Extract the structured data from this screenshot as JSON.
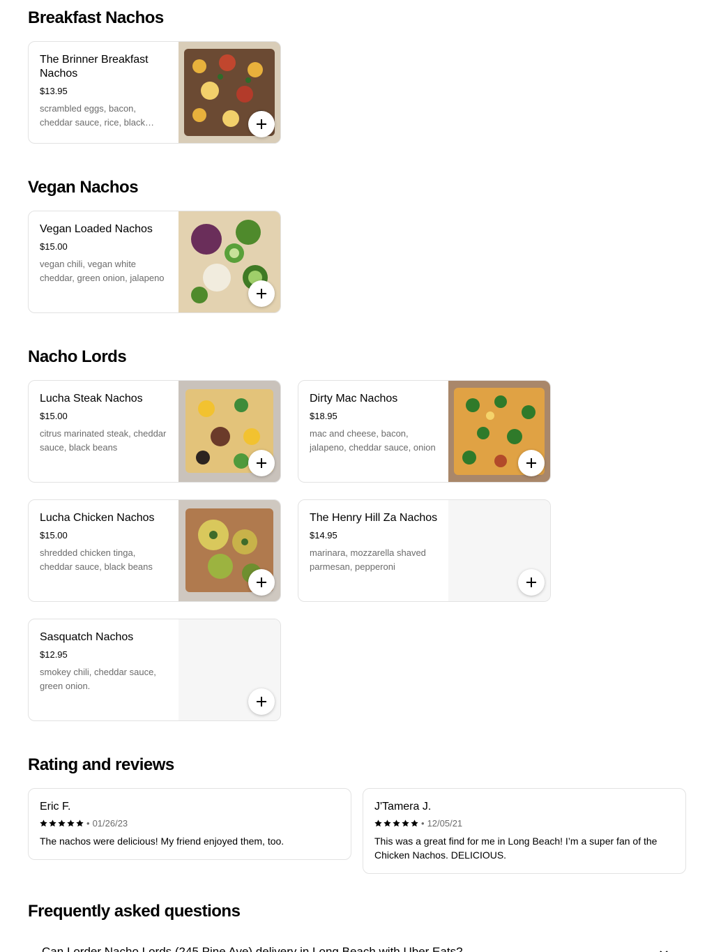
{
  "sections": {
    "breakfast": {
      "title": "Breakfast Nachos"
    },
    "vegan": {
      "title": "Vegan Nachos"
    },
    "lords": {
      "title": "Nacho Lords"
    },
    "reviews": {
      "title": "Rating and reviews"
    },
    "faq": {
      "title": "Frequently asked questions"
    }
  },
  "items": [
    {
      "name": "The Brinner Breakfast Nachos",
      "price": "$13.95",
      "description": "scrambled eggs, bacon, cheddar sauce, rice, black beans"
    },
    {
      "name": "Vegan Loaded Nachos",
      "price": "$15.00",
      "description": "vegan chili, vegan white cheddar, green onion, jalapeno"
    },
    {
      "name": "Lucha Steak Nachos",
      "price": "$15.00",
      "description": "citrus marinated steak, cheddar sauce, black beans"
    },
    {
      "name": "Dirty Mac Nachos",
      "price": "$18.95",
      "description": "mac and cheese, bacon, jalapeno, cheddar sauce, onion"
    },
    {
      "name": "Lucha Chicken Nachos",
      "price": "$15.00",
      "description": "shredded chicken tinga, cheddar sauce, black beans"
    },
    {
      "name": "The Henry Hill Za Nachos",
      "price": "$14.95",
      "description": "marinara, mozzarella shaved parmesan, pepperoni"
    },
    {
      "name": "Sasquatch Nachos",
      "price": "$12.95",
      "description": "smokey chili, cheddar sauce, green onion."
    }
  ],
  "reviews": [
    {
      "author": "Eric F.",
      "rating": 5,
      "date": "01/26/23",
      "text": "The nachos were delicious! My friend enjoyed them, too."
    },
    {
      "author": "J'Tamera J.",
      "rating": 5,
      "date": "12/05/21",
      "text": "This was a great find for me in Long Beach! I’m a super fan of the Chicken Nachos. DELICIOUS."
    }
  ],
  "faq": [
    {
      "question": "Can I order Nacho Lords (245 Pine Ave) delivery in Long Beach with Uber Eats?"
    }
  ],
  "icons": {
    "add": "plus-icon",
    "star": "star-icon",
    "chevron": "chevron-down-icon"
  },
  "colors": {
    "text": "#000000",
    "muted": "#6b6b6b",
    "border": "#e2e2e2",
    "placeholder": "#f6f6f6"
  }
}
